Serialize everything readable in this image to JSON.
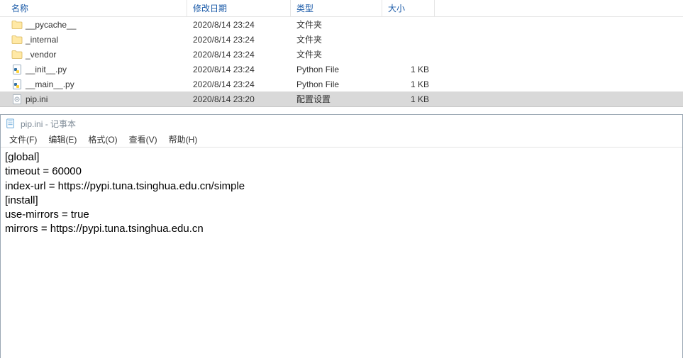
{
  "explorer": {
    "headers": {
      "name": "名称",
      "date": "修改日期",
      "type": "类型",
      "size": "大小"
    },
    "rows": [
      {
        "icon": "folder",
        "name": "__pycache__",
        "date": "2020/8/14 23:24",
        "type": "文件夹",
        "size": "",
        "selected": false
      },
      {
        "icon": "folder",
        "name": "_internal",
        "date": "2020/8/14 23:24",
        "type": "文件夹",
        "size": "",
        "selected": false
      },
      {
        "icon": "folder",
        "name": "_vendor",
        "date": "2020/8/14 23:24",
        "type": "文件夹",
        "size": "",
        "selected": false
      },
      {
        "icon": "pyfile",
        "name": "__init__.py",
        "date": "2020/8/14 23:24",
        "type": "Python File",
        "size": "1 KB",
        "selected": false
      },
      {
        "icon": "pyfile",
        "name": "__main__.py",
        "date": "2020/8/14 23:24",
        "type": "Python File",
        "size": "1 KB",
        "selected": false
      },
      {
        "icon": "inifile",
        "name": "pip.ini",
        "date": "2020/8/14 23:20",
        "type": "配置设置",
        "size": "1 KB",
        "selected": true
      }
    ]
  },
  "notepad": {
    "title": "pip.ini - 记事本",
    "menu": {
      "file": "文件(F)",
      "edit": "编辑(E)",
      "format": "格式(O)",
      "view": "查看(V)",
      "help": "帮助(H)"
    },
    "content": "[global]\ntimeout = 60000\nindex-url = https://pypi.tuna.tsinghua.edu.cn/simple\n[install]\nuse-mirrors = true\nmirrors = https://pypi.tuna.tsinghua.edu.cn"
  }
}
